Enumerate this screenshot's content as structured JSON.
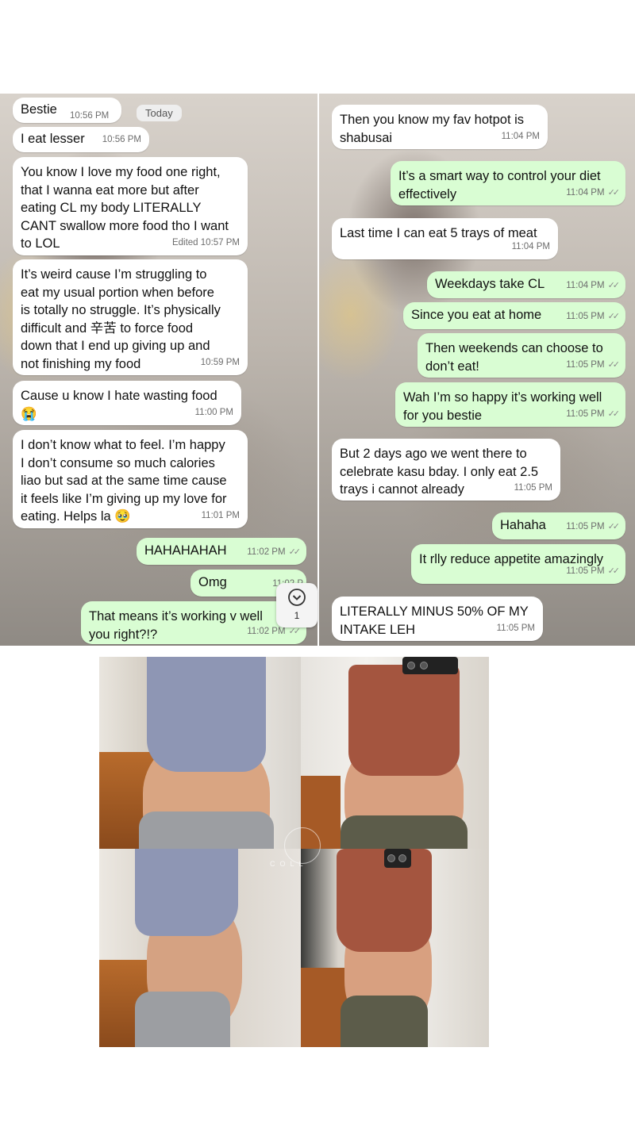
{
  "left_chat": {
    "contact_name": "Bestie",
    "contact_time": "10:56 PM",
    "day_label": "Today",
    "messages": [
      {
        "text": "I eat lesser",
        "time": "10:56 PM"
      },
      {
        "text": "You know I love my food one right,\nthat I wanna eat more but after\neating CL my body LITERALLY\nCANT swallow more food tho I want\nto LOL",
        "time": "Edited 10:57 PM"
      },
      {
        "text": "It’s weird cause I’m struggling to\neat my usual portion when before\nis totally no struggle. It’s physically\ndifficult and 辛苦 to force food\ndown that I end up giving up and\nnot finishing my food",
        "time": "10:59 PM"
      },
      {
        "text": "Cause u know I hate wasting food\n😭",
        "time": "11:00 PM"
      },
      {
        "text": "I don’t know what to feel. I’m happy\nI don’t consume so much calories\nliao but sad at the same time cause\nit feels like I’m giving up my love for\neating. Helps la 🥹",
        "time": "11:01 PM"
      },
      {
        "text": "HAHAHAHAH",
        "time": "11:02 PM"
      },
      {
        "text": "Omg",
        "time": "11:02 P"
      },
      {
        "text": "That means it’s working v well\nyou right?!?",
        "time": "11:02 PM"
      }
    ],
    "scroll_button": {
      "icon": "chevron-down-icon",
      "unread_count": "1"
    }
  },
  "right_chat": {
    "messages": [
      {
        "text": "Then you know my fav hotpot is\nshabusai",
        "time": "11:04 PM"
      },
      {
        "text": "It’s a smart way to control your diet\neffectively",
        "time": "11:04 PM"
      },
      {
        "text": "Last time I can eat 5 trays of meat",
        "time": "11:04 PM"
      },
      {
        "text": "Weekdays take CL",
        "time": "11:04 PM"
      },
      {
        "text": "Since you eat at home",
        "time": "11:05 PM"
      },
      {
        "text": "Then weekends can choose to\ndon’t eat!",
        "time": "11:05 PM"
      },
      {
        "text": "Wah I’m so happy it’s working well\nfor you bestie",
        "time": "11:05 PM"
      },
      {
        "text": "But 2 days ago we went there to\ncelebrate kasu bday. I only eat 2.5\ntrays i cannot already",
        "time": "11:05 PM"
      },
      {
        "text": "Hahaha",
        "time": "11:05 PM"
      },
      {
        "text": "It rlly reduce appetite amazingly",
        "time": "11:05 PM"
      },
      {
        "text": "LITERALLY MINUS 50% OF MY\nINTAKE LEH",
        "time": "11:05 PM"
      }
    ]
  },
  "photos": {
    "watermark": "COLL",
    "colors": {
      "incoming": "#ffffff",
      "outgoing": "#d9fdd3",
      "grey_top": "#8e96b4",
      "rust_top": "#a4553f"
    }
  }
}
